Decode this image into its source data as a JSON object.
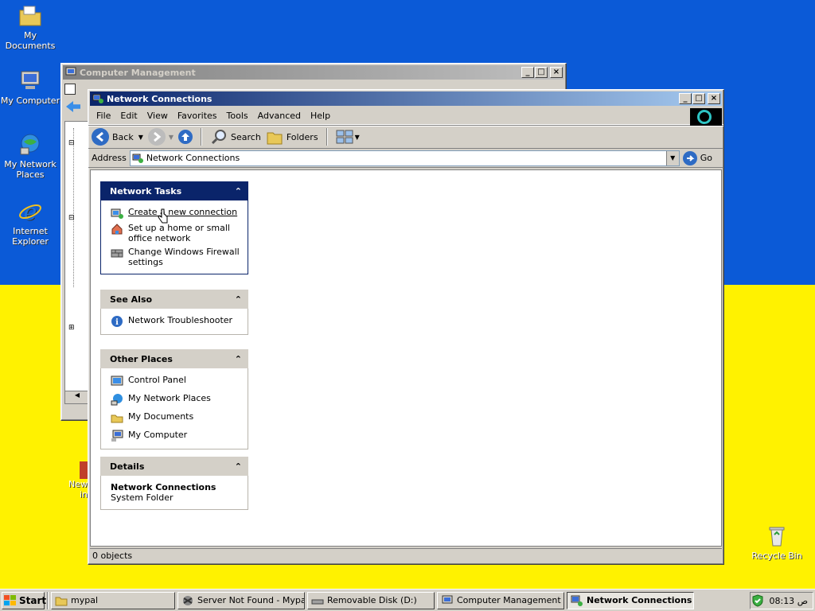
{
  "desktop": {
    "icons": [
      {
        "label": "My Documents",
        "icon": "folder-documents-icon"
      },
      {
        "label": "My Computer",
        "icon": "computer-icon"
      },
      {
        "label": "My Network Places",
        "icon": "network-places-icon"
      },
      {
        "label": "Internet Explorer",
        "icon": "internet-explorer-icon"
      },
      {
        "label": "Recycle Bin",
        "icon": "recycle-bin-icon"
      }
    ],
    "partial_icon_label": "New",
    "partial_icon_label2": "in",
    "colors": {
      "top": "#0b5ad7",
      "bottom": "#fff200"
    }
  },
  "back_window": {
    "title": "Computer Management"
  },
  "main_window": {
    "title": "Network Connections",
    "menu": [
      "File",
      "Edit",
      "View",
      "Favorites",
      "Tools",
      "Advanced",
      "Help"
    ],
    "toolbar": {
      "back": "Back",
      "search": "Search",
      "folders": "Folders"
    },
    "address": {
      "label": "Address",
      "value": "Network Connections",
      "go": "Go"
    },
    "panes": {
      "network_tasks": {
        "title": "Network Tasks",
        "items": [
          {
            "label": "Create a new connection",
            "icon": "new-connection-icon"
          },
          {
            "label": "Set up a home or small office network",
            "icon": "home-network-icon"
          },
          {
            "label": "Change Windows Firewall settings",
            "icon": "firewall-icon"
          }
        ]
      },
      "see_also": {
        "title": "See Also",
        "items": [
          {
            "label": "Network Troubleshooter",
            "icon": "info-icon"
          }
        ]
      },
      "other_places": {
        "title": "Other Places",
        "items": [
          {
            "label": "Control Panel",
            "icon": "control-panel-icon"
          },
          {
            "label": "My Network Places",
            "icon": "network-places-icon"
          },
          {
            "label": "My Documents",
            "icon": "folder-documents-icon"
          },
          {
            "label": "My Computer",
            "icon": "computer-icon"
          }
        ]
      },
      "details": {
        "title": "Details",
        "name": "Network Connections",
        "type": "System Folder"
      }
    },
    "status": "0 objects"
  },
  "taskbar": {
    "start": "Start",
    "buttons": [
      {
        "label": "mypal",
        "icon": "folder-icon"
      },
      {
        "label": "Server Not Found - Mypal",
        "icon": "mypal-browser-icon"
      },
      {
        "label": "Removable Disk (D:)",
        "icon": "removable-disk-icon"
      },
      {
        "label": "Computer Management",
        "icon": "computer-management-icon"
      },
      {
        "label": "Network Connections",
        "icon": "network-connections-icon"
      }
    ],
    "clock": "08:13 ص"
  }
}
